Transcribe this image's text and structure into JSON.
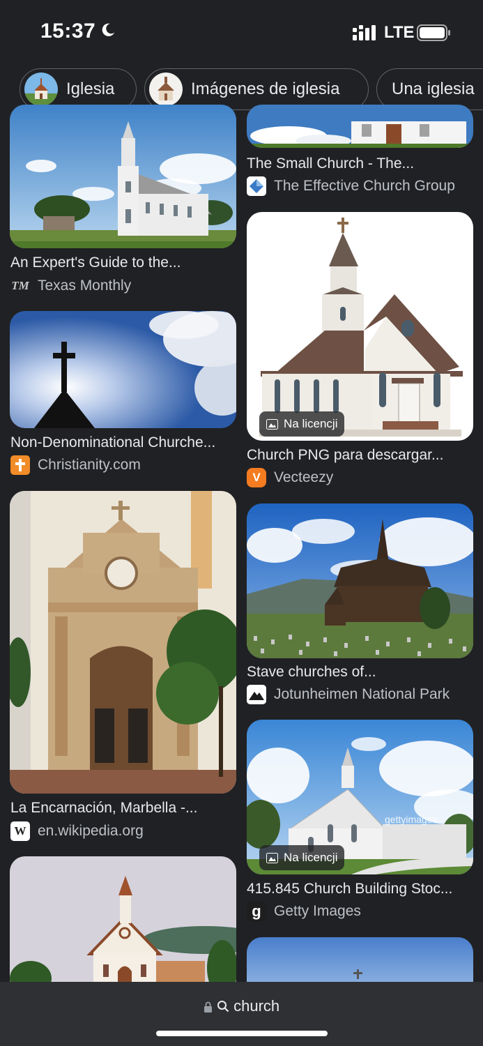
{
  "status_bar": {
    "time": "15:37",
    "carrier": "LTE",
    "icons": [
      "moon-icon",
      "signal-icon",
      "battery-icon"
    ]
  },
  "chips": [
    {
      "label": "Iglesia",
      "icon": "church-thumbnail"
    },
    {
      "label": "Imágenes de iglesia",
      "icon": "church-thumbnail"
    },
    {
      "label": "Una iglesia",
      "icon": ""
    }
  ],
  "results": [
    {
      "id": "small-church",
      "caption": "The Small Church - The...",
      "source": "The Effective Church Group",
      "favicon": "effective-church-icon",
      "badge": ""
    },
    {
      "id": "texas",
      "caption": "An Expert's Guide to the...",
      "source": "Texas Monthly",
      "favicon": "TM",
      "badge": ""
    },
    {
      "id": "church-png",
      "caption": "Church PNG para descargar...",
      "source": "Vecteezy",
      "favicon": "V",
      "badge": "Na licencji"
    },
    {
      "id": "nondenom",
      "caption": "Non-Denominational Churche...",
      "source": "Christianity.com",
      "favicon": "cross-icon",
      "badge": ""
    },
    {
      "id": "stave",
      "caption": "Stave churches of...",
      "source": "Jotunheimen National Park",
      "favicon": "mountain-icon",
      "badge": ""
    },
    {
      "id": "encarnacion",
      "caption": "La Encarnación, Marbella -...",
      "source": "en.wikipedia.org",
      "favicon": "W",
      "badge": ""
    },
    {
      "id": "getty",
      "caption": "415.845 Church Building Stoc...",
      "source": "Getty Images",
      "favicon": "g",
      "badge": "Na licencji"
    }
  ],
  "image_text": {
    "getty_watermark": "gettyimages"
  },
  "address_bar": {
    "query": "church"
  },
  "colors": {
    "background": "#202124",
    "bar": "#2f3033",
    "chip_border": "#5f6368",
    "vecteezy": "#f47b20",
    "christianity": "#f28c28"
  }
}
